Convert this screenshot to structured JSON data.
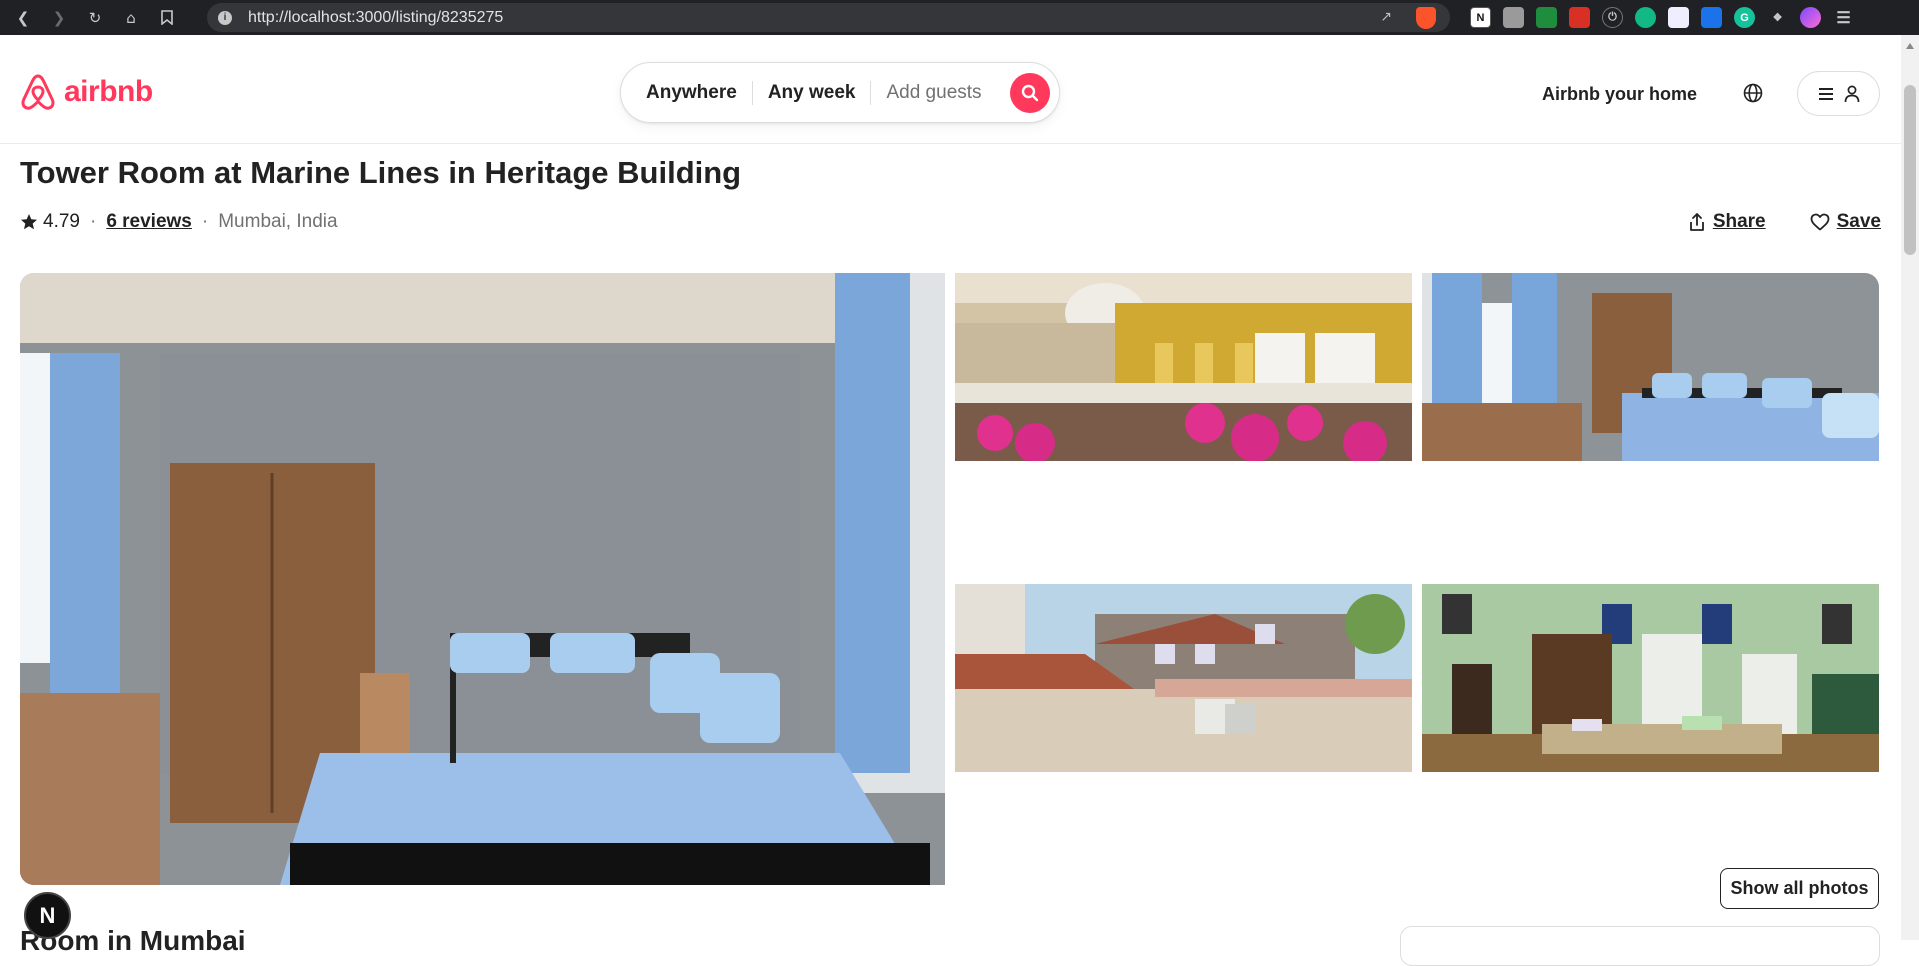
{
  "browser": {
    "url": "http://localhost:3000/listing/8235275"
  },
  "brand": {
    "name": "airbnb",
    "accent": "#ff385c"
  },
  "search": {
    "where": "Anywhere",
    "when": "Any week",
    "who": "Add guests"
  },
  "header": {
    "host_link": "Airbnb your home"
  },
  "listing": {
    "title": "Tower Room at Marine Lines in Heritage Building",
    "rating": "4.79",
    "reviews": "6 reviews",
    "location": "Mumbai, India",
    "share_label": "Share",
    "save_label": "Save",
    "show_all_photos": "Show all photos",
    "next_heading": "Room in Mumbai"
  },
  "badge": {
    "letter": "N"
  }
}
